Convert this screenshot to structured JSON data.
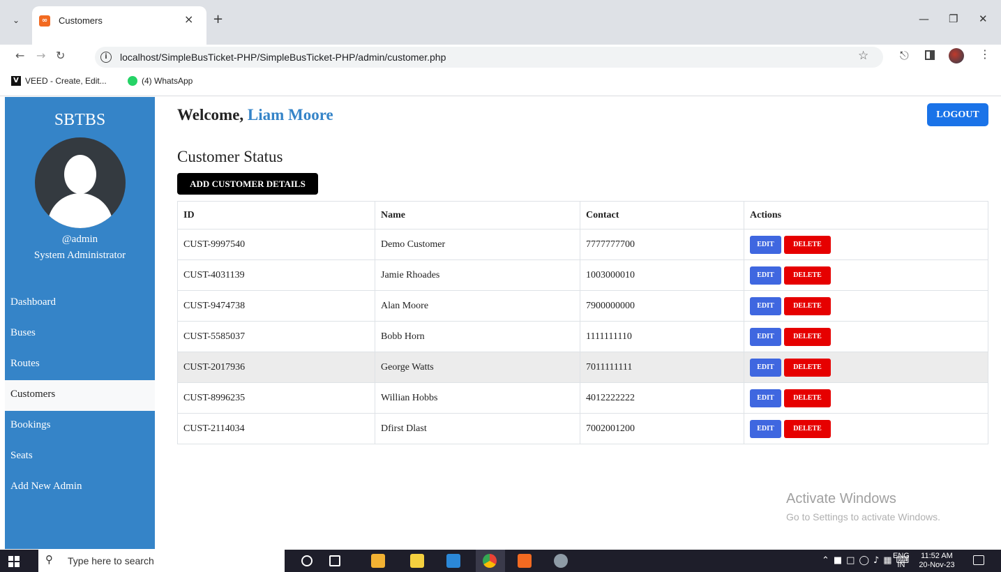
{
  "browser": {
    "tab_title": "Customers",
    "url": "localhost/SimpleBusTicket-PHP/SimpleBusTicket-PHP/admin/customer.php",
    "bookmarks": [
      "VEED - Create, Edit...",
      "(4) WhatsApp"
    ]
  },
  "sidebar": {
    "brand": "SBTBS",
    "username": "@admin",
    "role": "System Administrator",
    "items": [
      "Dashboard",
      "Buses",
      "Routes",
      "Customers",
      "Bookings",
      "Seats",
      "Add New Admin"
    ],
    "active_item": "Customers"
  },
  "header": {
    "welcome_label": "Welcome,",
    "user_name": "Liam Moore",
    "logout_label": "LOGOUT"
  },
  "main": {
    "section_title": "Customer Status",
    "add_button_label": "ADD CUSTOMER DETAILS",
    "table": {
      "headers": [
        "ID",
        "Name",
        "Contact",
        "Actions"
      ],
      "rows": [
        {
          "id": "CUST-9997540",
          "name": "Demo Customer",
          "contact": "7777777700"
        },
        {
          "id": "CUST-4031139",
          "name": "Jamie Rhoades",
          "contact": "1003000010"
        },
        {
          "id": "CUST-9474738",
          "name": "Alan Moore",
          "contact": "7900000000"
        },
        {
          "id": "CUST-5585037",
          "name": "Bobb Horn",
          "contact": "1111111110"
        },
        {
          "id": "CUST-2017936",
          "name": "George Watts",
          "contact": "7011111111"
        },
        {
          "id": "CUST-8996235",
          "name": "Willian Hobbs",
          "contact": "4012222222"
        },
        {
          "id": "CUST-2114034",
          "name": "Dfirst Dlast",
          "contact": "7002001200"
        }
      ],
      "edit_label": "EDIT",
      "delete_label": "DELETE"
    }
  },
  "watermark": {
    "line1": "Activate Windows",
    "line2": "Go to Settings to activate Windows."
  },
  "taskbar": {
    "search_placeholder": "Type here to search",
    "lang_line1": "ENG",
    "lang_line2": "IN",
    "time": "11:52 AM",
    "date": "20-Nov-23"
  },
  "colors": {
    "sidebar": "#3584c8",
    "accent": "#3584c8",
    "logout": "#1a73e8",
    "edit": "#3f67e0",
    "delete": "#e60000"
  }
}
